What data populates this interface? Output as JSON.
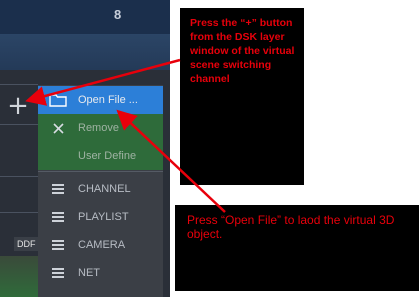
{
  "app": {
    "top_number": "8",
    "plus_symbol": "+",
    "ddf_label": "DDF"
  },
  "menu": {
    "items": [
      {
        "label": "Open File ...",
        "icon": "folder-icon"
      },
      {
        "label": "Remove",
        "icon": "close-icon"
      },
      {
        "label": "User Define",
        "icon": ""
      },
      {
        "label": "CHANNEL",
        "icon": "menu-icon"
      },
      {
        "label": "PLAYLIST",
        "icon": "menu-icon"
      },
      {
        "label": "CAMERA",
        "icon": "menu-icon"
      },
      {
        "label": "NET",
        "icon": "menu-icon"
      }
    ]
  },
  "callouts": {
    "first": "Press the “+” button from the DSK layer window of the virtual scene switching channel",
    "second": "Press “Open File” to laod the virtual 3D object."
  },
  "colors": {
    "callout_text": "#e8000b",
    "callout_bg": "#000000",
    "menu_highlight": "#2c7fd8",
    "menu_green": "#2e6b3a",
    "arrow": "#e8000b"
  }
}
